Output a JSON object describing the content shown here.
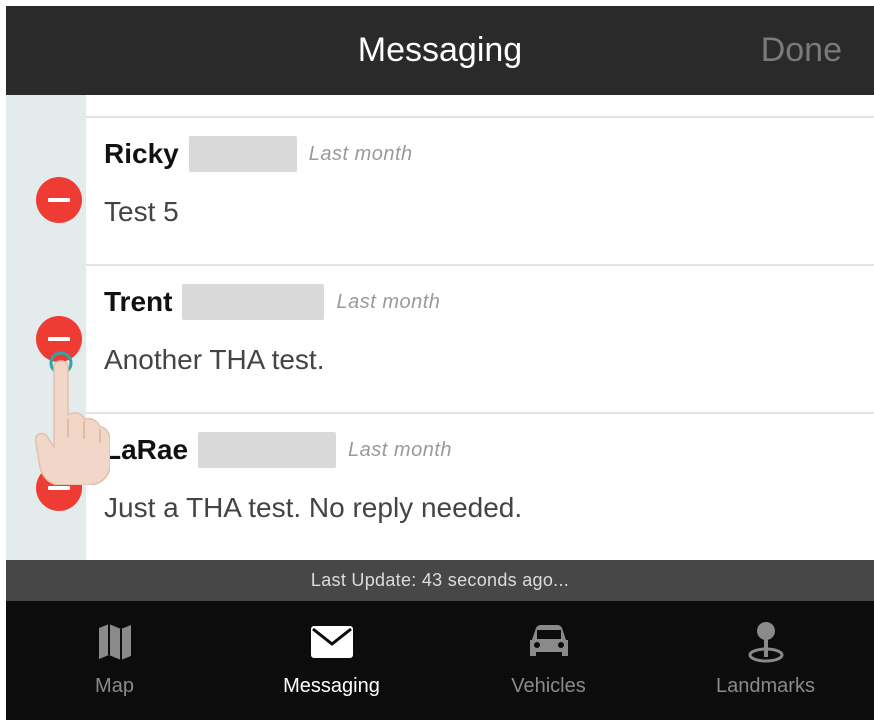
{
  "header": {
    "title": "Messaging",
    "done_label": "Done"
  },
  "messages": [
    {
      "sender": "Ricky",
      "time": "Last month",
      "preview": "Test 5"
    },
    {
      "sender": "Trent",
      "time": "Last month",
      "preview": "Another THA test."
    },
    {
      "sender": "LaRae",
      "time": "Last month",
      "preview": "Just a THA test. No reply needed."
    }
  ],
  "status": {
    "text": "Last Update: 43 seconds ago..."
  },
  "tabs": [
    {
      "label": "Map",
      "icon": "map-icon",
      "active": false
    },
    {
      "label": "Messaging",
      "icon": "envelope-icon",
      "active": true
    },
    {
      "label": "Vehicles",
      "icon": "car-icon",
      "active": false
    },
    {
      "label": "Landmarks",
      "icon": "pin-icon",
      "active": false
    }
  ],
  "colors": {
    "header_bg": "#2a2a2a",
    "delete_red": "#ee3b34",
    "edit_gutter": "#e3ebec",
    "tab_bar_bg": "#0c0c0c",
    "status_bar_bg": "#474747"
  }
}
